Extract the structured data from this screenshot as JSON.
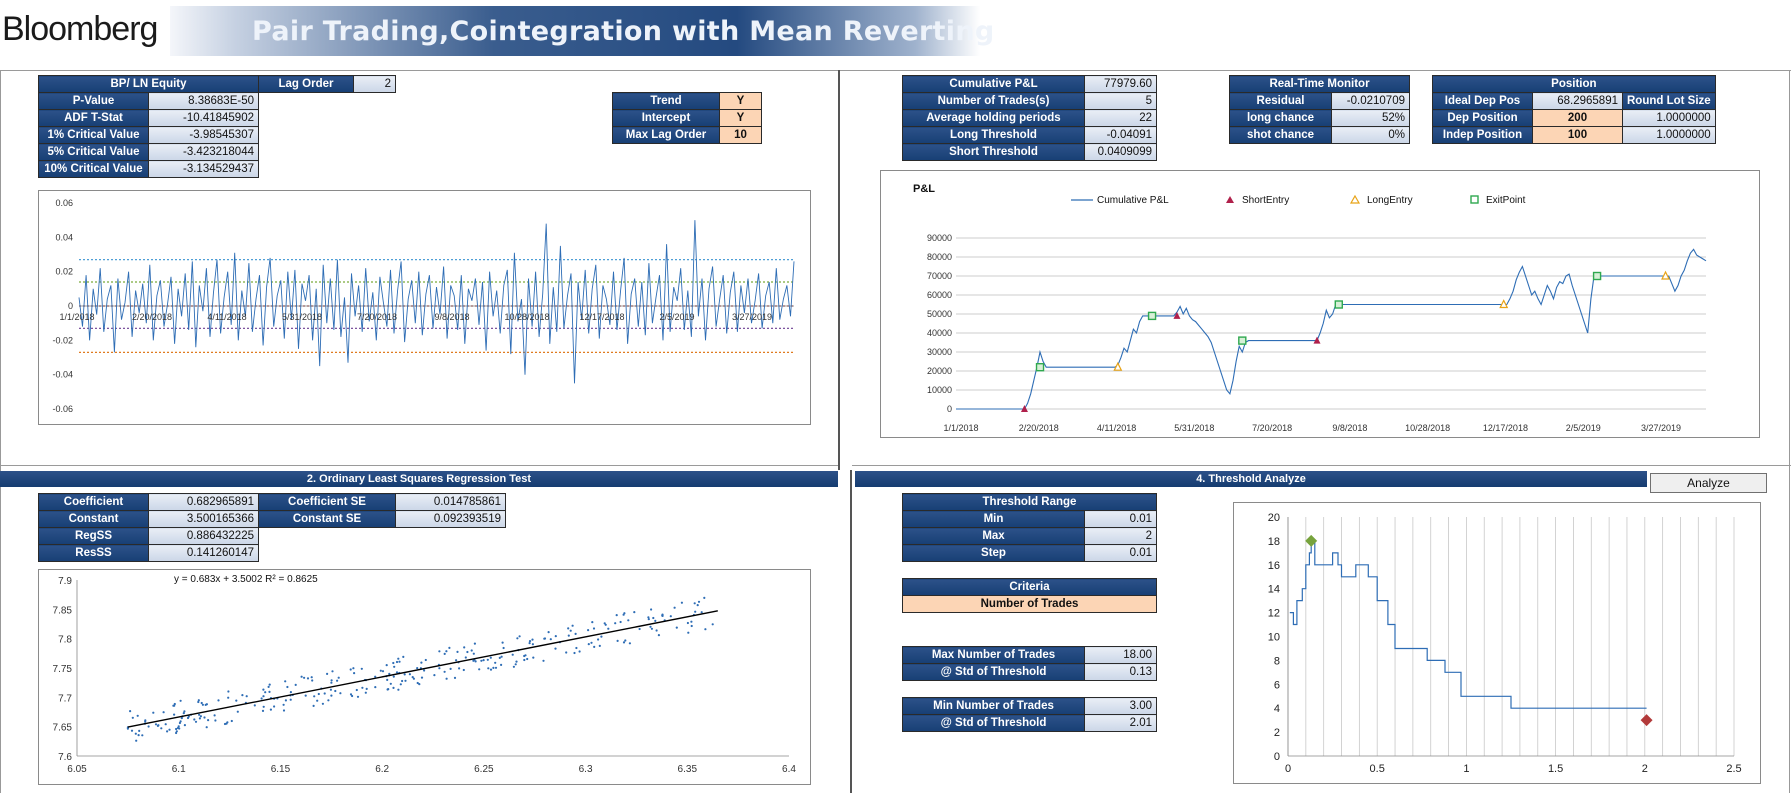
{
  "header": {
    "logo": "Bloomberg",
    "title": "Pair Trading,Cointegration with Mean Reverting"
  },
  "adf": {
    "title": "BP/ LN Equity",
    "rows": [
      {
        "label": "P-Value",
        "value": "8.38683E-50"
      },
      {
        "label": "ADF T-Stat",
        "value": "-10.41845902"
      },
      {
        "label": "1% Critical Value",
        "value": "-3.98545307"
      },
      {
        "label": "5% Critical Value",
        "value": "-3.423218044"
      },
      {
        "label": "10% Critical Value",
        "value": "-3.134529437"
      }
    ],
    "lag_label": "Lag Order",
    "lag_value": "2"
  },
  "settings": {
    "rows": [
      {
        "label": "Trend",
        "value": "Y"
      },
      {
        "label": "Intercept",
        "value": "Y"
      },
      {
        "label": "Max Lag Order",
        "value": "10"
      }
    ]
  },
  "stats": {
    "rows": [
      {
        "label": "Cumulative P&L",
        "value": "77979.60"
      },
      {
        "label": "Number of Trades(s)",
        "value": "5"
      },
      {
        "label": "Average holding periods",
        "value": "22"
      },
      {
        "label": "Long Threshold",
        "value": "-0.04091"
      },
      {
        "label": "Short Threshold",
        "value": "0.0409099"
      }
    ]
  },
  "monitor": {
    "title": "Real-Time Monitor",
    "rows": [
      {
        "label": "Residual",
        "value": "-0.0210709"
      },
      {
        "label": "long chance",
        "value": "52%"
      },
      {
        "label": "shot chance",
        "value": "0%"
      }
    ]
  },
  "position": {
    "title": "Position",
    "round_lot_label": "Round Lot Size",
    "rows": [
      {
        "label": "Ideal Dep Pos",
        "value": "68.2965891"
      },
      {
        "label": "Dep Position",
        "value": "200",
        "lot": "1.0000000"
      },
      {
        "label": "Indep Position",
        "value": "100",
        "lot": "1.0000000"
      }
    ]
  },
  "ols": {
    "section_title": "2. Ordinary Least Squares Regression Test",
    "left_rows": [
      {
        "label": "Coefficient",
        "value": "0.682965891"
      },
      {
        "label": "Constant",
        "value": "3.500165366"
      },
      {
        "label": "RegSS",
        "value": "0.886432225"
      },
      {
        "label": "ResSS",
        "value": "0.141260147"
      }
    ],
    "right_rows": [
      {
        "label": "Coefficient SE",
        "value": "0.014785861"
      },
      {
        "label": "Constant SE",
        "value": "0.092393519"
      }
    ]
  },
  "threshold": {
    "section_title": "4. Threshold Analyze",
    "analyze_button": "Analyze",
    "range_title": "Threshold Range",
    "range_rows": [
      {
        "label": "Min",
        "value": "0.01"
      },
      {
        "label": "Max",
        "value": "2"
      },
      {
        "label": "Step",
        "value": "0.01"
      }
    ],
    "criteria_title": "Criteria",
    "criteria_value": "Number of Trades",
    "max_rows": [
      {
        "label": "Max Number of Trades",
        "value": "18.00"
      },
      {
        "label": "@ Std of Threshold",
        "value": "0.13"
      }
    ],
    "min_rows": [
      {
        "label": "Min Number of Trades",
        "value": "3.00"
      },
      {
        "label": "@ Std of Threshold",
        "value": "2.01"
      }
    ]
  },
  "chart_data": [
    {
      "type": "line",
      "title": "",
      "x_ticks": [
        "1/1/2018",
        "2/20/2018",
        "4/11/2018",
        "5/31/2018",
        "7/20/2018",
        "9/8/2018",
        "10/28/2018",
        "12/17/2018",
        "2/5/2019",
        "3/27/2019"
      ],
      "y_ticks": [
        "0.06",
        "0.04",
        "0.02",
        "0",
        "-0.02",
        "-0.04",
        "-0.06"
      ],
      "ylim": [
        -0.06,
        0.06
      ],
      "reference_lines": [
        0.027,
        0.014,
        0.0,
        -0.013,
        -0.027
      ],
      "series": [
        {
          "values": [
            0.005,
            -0.012,
            0.018,
            -0.02,
            0.01,
            -0.005,
            0.022,
            -0.015,
            0.004,
            0.012,
            -0.027,
            0.016,
            -0.008,
            0.002,
            0.02,
            -0.018,
            0.009,
            -0.004,
            0.013,
            -0.01,
            0.024,
            -0.02,
            0.006,
            0.015,
            -0.012,
            0.001,
            0.017,
            -0.022,
            0.01,
            -0.006,
            0.019,
            -0.014,
            0.026,
            -0.024,
            0.012,
            -0.003,
            0.022,
            -0.018,
            0.008,
            0.027,
            -0.016,
            0.005,
            0.02,
            -0.011,
            0.031,
            -0.02,
            0.009,
            -0.006,
            0.025,
            -0.015,
            0.004,
            0.018,
            -0.023,
            0.011,
            0.028,
            -0.012,
            0.006,
            0.015,
            -0.019,
            0.02,
            -0.008,
            0.021,
            -0.025,
            0.013,
            0.003,
            0.018,
            -0.02,
            0.01,
            -0.035,
            0.024,
            -0.01,
            0.016,
            -0.014,
            0.027,
            -0.018,
            0.005,
            -0.033,
            0.019,
            -0.006,
            0.012,
            -0.015,
            0.022,
            -0.009,
            0.008,
            -0.02,
            0.017,
            0.002,
            -0.012,
            0.021,
            -0.016,
            0.009,
            0.026,
            -0.021,
            0.004,
            0.015,
            -0.01,
            0.02,
            -0.017,
            0.007,
            0.018,
            -0.013,
            0.011,
            -0.005,
            0.023,
            -0.019,
            0.012,
            0.006,
            -0.014,
            0.018,
            -0.022,
            0.01,
            0.003,
            0.016,
            -0.011,
            0.014,
            -0.026,
            0.02,
            -0.006,
            0.009,
            -0.016,
            0.012,
            0.021,
            -0.028,
            0.031,
            -0.009,
            0.004,
            -0.04,
            0.016,
            -0.012,
            0.02,
            -0.018,
            0.007,
            0.048,
            -0.022,
            0.011,
            -0.015,
            0.035,
            -0.013,
            0.006,
            0.019,
            -0.045,
            0.014,
            -0.008,
            0.021,
            -0.016,
            0.01,
            0.024,
            -0.019,
            0.012,
            0.004,
            -0.011,
            0.02,
            -0.014,
            0.009,
            0.028,
            -0.022,
            0.007,
            0.016,
            -0.012,
            0.014,
            -0.017,
            0.025,
            -0.01,
            0.005,
            0.018,
            -0.02,
            0.036,
            -0.015,
            0.011,
            0.003,
            0.022,
            -0.014,
            0.009,
            -0.018,
            0.05,
            -0.006,
            0.016,
            -0.02,
            0.01,
            0.023,
            -0.012,
            0.004,
            0.018,
            -0.016,
            0.008,
            0.02,
            -0.015,
            0.012,
            -0.004,
            0.016,
            -0.01,
            0.003,
            0.019,
            -0.013,
            0.006,
            0.014,
            -0.01,
            0.022,
            -0.008,
            0.004,
            0.012,
            -0.006,
            0.026
          ]
        }
      ]
    },
    {
      "type": "line",
      "title": "P&L",
      "x_ticks": [
        "1/1/2018",
        "2/20/2018",
        "4/11/2018",
        "5/31/2018",
        "7/20/2018",
        "9/8/2018",
        "10/28/2018",
        "12/17/2018",
        "2/5/2019",
        "3/27/2019"
      ],
      "y_ticks": [
        "90000",
        "80000",
        "70000",
        "60000",
        "50000",
        "40000",
        "30000",
        "20000",
        "10000",
        "0"
      ],
      "ylim": [
        0,
        90000
      ],
      "legend": [
        "Cumulative P&L",
        "ShortEntry",
        "LongEntry",
        "ExitPoint"
      ],
      "series": [
        {
          "name": "Cumulative P&L",
          "values": [
            0,
            0,
            0,
            0,
            0,
            0,
            0,
            0,
            0,
            0,
            0,
            0,
            0,
            0,
            0,
            0,
            0,
            0,
            0,
            0,
            0,
            0,
            0,
            3000,
            8000,
            15000,
            22000,
            30000,
            25000,
            22000,
            22000,
            22000,
            22000,
            22000,
            22000,
            22000,
            22000,
            22000,
            22000,
            22000,
            22000,
            22000,
            22000,
            22000,
            22000,
            22000,
            22000,
            22000,
            22000,
            22000,
            22000,
            22000,
            23000,
            27000,
            32000,
            30000,
            36000,
            42000,
            40000,
            46000,
            49000,
            49000,
            49000,
            49000,
            49000,
            49000,
            49000,
            49000,
            49000,
            49000,
            49000,
            51000,
            54000,
            50000,
            53000,
            49000,
            47000,
            46000,
            44000,
            42000,
            40000,
            38000,
            35000,
            30000,
            25000,
            20000,
            15000,
            10000,
            8000,
            15000,
            25000,
            33000,
            30000,
            35000,
            36000,
            36000,
            36000,
            36000,
            36000,
            36000,
            36000,
            36000,
            36000,
            36000,
            36000,
            36000,
            36000,
            36000,
            36000,
            36000,
            36000,
            36000,
            36000,
            36000,
            36000,
            36000,
            36000,
            40000,
            45000,
            52000,
            48000,
            50000,
            55000,
            55000,
            55000,
            55000,
            55000,
            55000,
            55000,
            55000,
            55000,
            55000,
            55000,
            55000,
            55000,
            55000,
            55000,
            55000,
            55000,
            55000,
            55000,
            55000,
            55000,
            55000,
            55000,
            55000,
            55000,
            55000,
            55000,
            55000,
            55000,
            55000,
            55000,
            55000,
            55000,
            55000,
            55000,
            55000,
            55000,
            55000,
            55000,
            55000,
            55000,
            55000,
            55000,
            55000,
            55000,
            55000,
            55000,
            55000,
            55000,
            55000,
            55000,
            55000,
            55000,
            55000,
            55000,
            55000,
            58000,
            62000,
            68000,
            72000,
            75000,
            70000,
            65000,
            60000,
            62000,
            58000,
            55000,
            60000,
            65000,
            62000,
            58000,
            64000,
            67000,
            66000,
            70000,
            71000,
            65000,
            60000,
            55000,
            50000,
            45000,
            40000,
            58000,
            70000,
            70000,
            70000,
            70000,
            70000,
            70000,
            70000,
            70000,
            70000,
            70000,
            70000,
            70000,
            70000,
            70000,
            70000,
            70000,
            70000,
            70000,
            70000,
            70000,
            70000,
            70000,
            70000,
            70000,
            70000,
            66000,
            62000,
            65000,
            70000,
            73000,
            78000,
            82000,
            84000,
            81000,
            80000,
            79000,
            78000
          ]
        }
      ],
      "markers": {
        "ShortEntry": [
          {
            "x": 22,
            "y": 0
          },
          {
            "x": 71,
            "y": 49000
          },
          {
            "x": 116,
            "y": 36000
          }
        ],
        "LongEntry": [
          {
            "x": 52,
            "y": 22000
          },
          {
            "x": 176,
            "y": 55000
          },
          {
            "x": 228,
            "y": 70000
          }
        ],
        "ExitPoint": [
          {
            "x": 27,
            "y": 22000
          },
          {
            "x": 63,
            "y": 49000
          },
          {
            "x": 92,
            "y": 36000
          },
          {
            "x": 123,
            "y": 55000
          },
          {
            "x": 206,
            "y": 70000
          }
        ]
      }
    },
    {
      "type": "scatter",
      "title": "",
      "annotation": "y = 0.683x + 3.5002     R² = 0.8625",
      "x_ticks": [
        "6.05",
        "6.1",
        "6.15",
        "6.2",
        "6.25",
        "6.3",
        "6.35",
        "6.4"
      ],
      "y_ticks": [
        "7.9",
        "7.85",
        "7.8",
        "7.75",
        "7.7",
        "7.65",
        "7.6"
      ],
      "xlim": [
        6.05,
        6.4
      ],
      "ylim": [
        7.6,
        7.9
      ],
      "trendline": {
        "slope": 0.683,
        "intercept": 3.5002,
        "x_range": [
          6.075,
          6.365
        ]
      }
    },
    {
      "type": "line",
      "title": "",
      "x_ticks": [
        "0",
        "0.5",
        "1",
        "1.5",
        "2",
        "2.5"
      ],
      "y_ticks": [
        "20",
        "18",
        "16",
        "14",
        "12",
        "10",
        "8",
        "6",
        "4",
        "2",
        "0"
      ],
      "xlim": [
        0,
        2.5
      ],
      "ylim": [
        0,
        20
      ],
      "series": [
        {
          "values": [
            [
              0.01,
              12
            ],
            [
              0.03,
              11
            ],
            [
              0.05,
              13
            ],
            [
              0.08,
              14
            ],
            [
              0.1,
              16
            ],
            [
              0.12,
              17
            ],
            [
              0.13,
              18
            ],
            [
              0.15,
              16
            ],
            [
              0.2,
              16
            ],
            [
              0.25,
              17
            ],
            [
              0.28,
              16
            ],
            [
              0.3,
              15
            ],
            [
              0.36,
              15
            ],
            [
              0.38,
              16
            ],
            [
              0.42,
              16
            ],
            [
              0.45,
              15
            ],
            [
              0.5,
              13
            ],
            [
              0.52,
              13
            ],
            [
              0.56,
              11
            ],
            [
              0.6,
              9
            ],
            [
              0.75,
              9
            ],
            [
              0.78,
              8
            ],
            [
              0.85,
              8
            ],
            [
              0.88,
              7
            ],
            [
              0.95,
              7
            ],
            [
              0.97,
              5
            ],
            [
              1.2,
              5
            ],
            [
              1.25,
              4
            ],
            [
              2.01,
              4
            ]
          ]
        }
      ],
      "markers": [
        {
          "x": 0.13,
          "y": 18,
          "color": "#77a33d",
          "label": "max"
        },
        {
          "x": 2.01,
          "y": 3,
          "color": "#b23a3a",
          "label": "min"
        }
      ],
      "vgrid_step": 0.1
    }
  ],
  "colors": {
    "series": "#2e6db5",
    "header": "#1f477d",
    "input": "#fcd5b5",
    "short": "#b0204b",
    "long": "#e8a317",
    "exit": "#2fa84f"
  }
}
